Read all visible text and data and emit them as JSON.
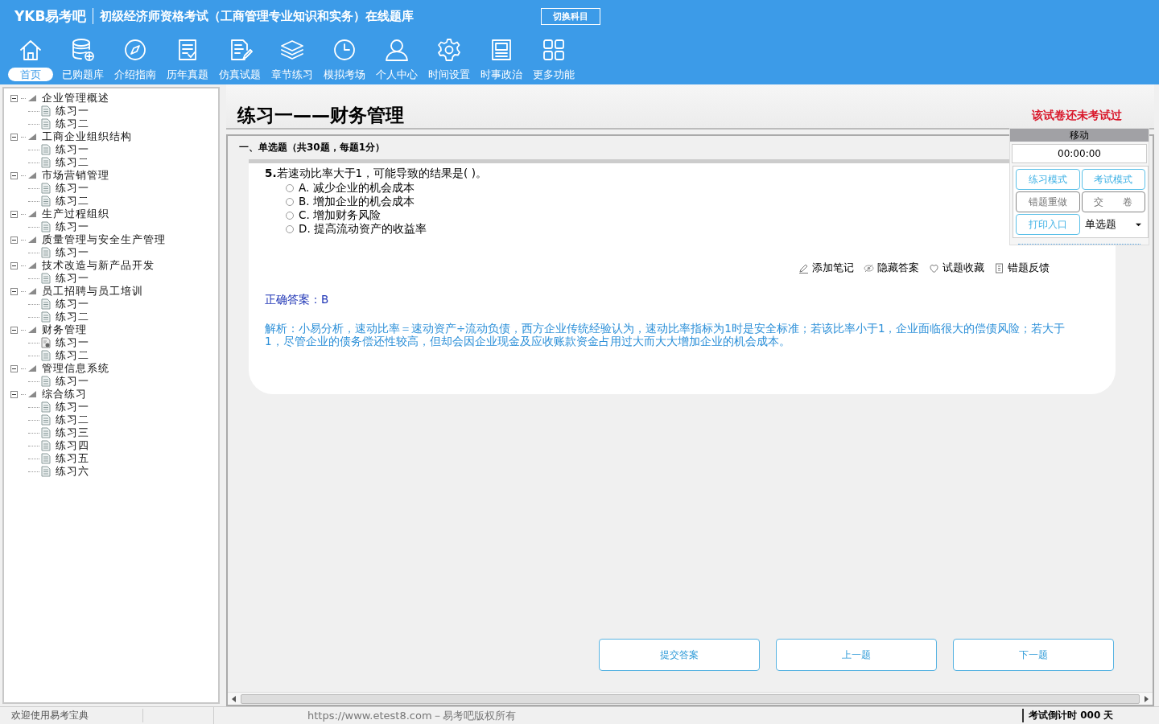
{
  "header": {
    "logo": "YKB易考吧",
    "title": "初级经济师资格考试（工商管理专业知识和实务）在线题库",
    "switch_button": "切换科目"
  },
  "nav": [
    {
      "label": "首页",
      "selected": true
    },
    {
      "label": "已购题库",
      "selected": false
    },
    {
      "label": "介绍指南",
      "selected": false
    },
    {
      "label": "历年真题",
      "selected": false
    },
    {
      "label": "仿真试题",
      "selected": false
    },
    {
      "label": "章节练习",
      "selected": false
    },
    {
      "label": "模拟考场",
      "selected": false
    },
    {
      "label": "个人中心",
      "selected": false
    },
    {
      "label": "时间设置",
      "selected": false
    },
    {
      "label": "时事政治",
      "selected": false
    },
    {
      "label": "更多功能",
      "selected": false
    }
  ],
  "tree": [
    {
      "label": "企业管理概述",
      "expanded": true,
      "children": [
        {
          "label": "练习一",
          "kind": "doc"
        },
        {
          "label": "练习二",
          "kind": "doc"
        }
      ]
    },
    {
      "label": "工商企业组织结构",
      "expanded": true,
      "children": [
        {
          "label": "练习一",
          "kind": "doc"
        },
        {
          "label": "练习二",
          "kind": "doc"
        }
      ]
    },
    {
      "label": "市场营销管理",
      "expanded": true,
      "children": [
        {
          "label": "练习一",
          "kind": "doc"
        },
        {
          "label": "练习二",
          "kind": "doc"
        }
      ]
    },
    {
      "label": "生产过程组织",
      "expanded": true,
      "children": [
        {
          "label": "练习一",
          "kind": "doc"
        }
      ]
    },
    {
      "label": "质量管理与安全生产管理",
      "expanded": true,
      "children": [
        {
          "label": "练习一",
          "kind": "doc"
        }
      ]
    },
    {
      "label": "技术改造与新产品开发",
      "expanded": true,
      "children": [
        {
          "label": "练习一",
          "kind": "doc"
        }
      ]
    },
    {
      "label": "员工招聘与员工培训",
      "expanded": true,
      "children": [
        {
          "label": "练习一",
          "kind": "doc"
        },
        {
          "label": "练习二",
          "kind": "doc"
        }
      ]
    },
    {
      "label": "财务管理",
      "expanded": true,
      "children": [
        {
          "label": "练习一",
          "kind": "current"
        },
        {
          "label": "练习二",
          "kind": "doc"
        }
      ]
    },
    {
      "label": "管理信息系统",
      "expanded": true,
      "children": [
        {
          "label": "练习一",
          "kind": "doc"
        }
      ]
    },
    {
      "label": "综合练习",
      "expanded": true,
      "children": [
        {
          "label": "练习一",
          "kind": "doc"
        },
        {
          "label": "练习二",
          "kind": "doc"
        },
        {
          "label": "练习三",
          "kind": "doc"
        },
        {
          "label": "练习四",
          "kind": "doc"
        },
        {
          "label": "练习五",
          "kind": "doc"
        },
        {
          "label": "练习六",
          "kind": "doc"
        }
      ]
    }
  ],
  "page_title": "练习一——财务管理",
  "exam_status": "该试卷还未考试过",
  "section": "一、单选题（共30题，每题1分）",
  "question": {
    "number": "5.",
    "text": "若速动比率大于1，可能导致的结果是( )。",
    "options": [
      {
        "letter": "A.",
        "text": "减少企业的机会成本",
        "selected": false
      },
      {
        "letter": "B.",
        "text": "增加企业的机会成本",
        "selected": false
      },
      {
        "letter": "C.",
        "text": "增加财务风险",
        "selected": false
      },
      {
        "letter": "D.",
        "text": "提高流动资产的收益率",
        "selected": false
      }
    ],
    "actions": [
      "添加笔记",
      "隐藏答案",
      "试题收藏",
      "错题反馈"
    ],
    "answer": "正确答案：B",
    "analysis": "解析：小易分析，速动比率＝速动资产÷流动负债，西方企业传统经验认为，速动比率指标为1时是安全标准；若该比率小于1，企业面临很大的偿债风险；若大于1，尽管企业的债务偿还性较高，但却会因企业现金及应收账款资金占用过大而大大增加企业的机会成本。"
  },
  "panel": {
    "title": "移动",
    "timer": "00:00:00",
    "buttons": [
      {
        "label": "练习模式",
        "disabled": false
      },
      {
        "label": "考试模式",
        "disabled": false
      },
      {
        "label": "错题重做",
        "disabled": true
      },
      {
        "label": "交　　卷",
        "disabled": true
      },
      {
        "label": "打印入口",
        "disabled": false
      }
    ],
    "type_select": "单选题"
  },
  "bottom_buttons": [
    "提交答案",
    "上一题",
    "下一题"
  ],
  "status_bar": {
    "welcome": "欢迎使用易考宝典",
    "copyright": "https://www.etest8.com－易考吧版权所有",
    "countdown": "考试倒计时 000 天"
  }
}
